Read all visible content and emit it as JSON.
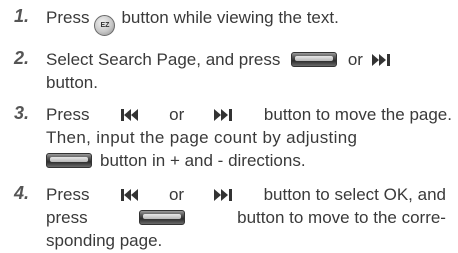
{
  "steps": [
    {
      "number": "1.",
      "parts": {
        "a": "Press",
        "b": "button while viewing the text."
      },
      "ez_label": "EZ"
    },
    {
      "number": "2.",
      "line1": {
        "a": "Select Search Page, and press",
        "b": "or"
      },
      "line2": "button."
    },
    {
      "number": "3.",
      "line1": {
        "a": "Press",
        "b": "or",
        "c": "button to move the page."
      },
      "line2": "Then, input the page count by adjusting",
      "line3": "button in + and - directions."
    },
    {
      "number": "4.",
      "line1": {
        "a": "Press",
        "b": "or",
        "c": "button to select OK, and"
      },
      "line2": {
        "a": "press",
        "b": "button to move to the corre-"
      },
      "line3": "sponding page."
    }
  ],
  "icons": {
    "ez_button": "ez-button-icon",
    "wheel_button": "jog-wheel-button-icon",
    "skip_back": "skip-back-icon",
    "skip_forward": "skip-forward-icon"
  },
  "colors": {
    "text": "#3a3a3a",
    "number": "#555555"
  }
}
